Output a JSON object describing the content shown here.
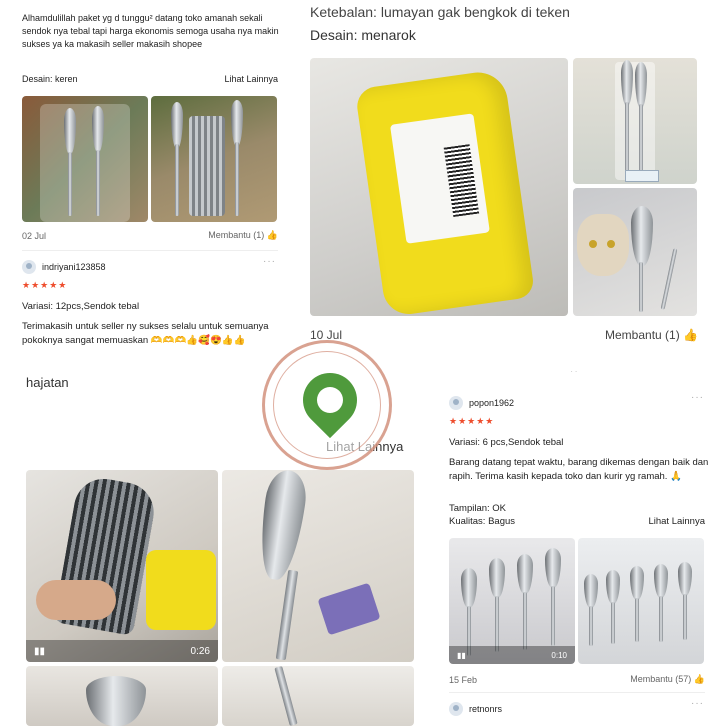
{
  "panel1": {
    "review_text": "Alhamdulillah paket yg d tunggu² datang toko amanah sekali sendok nya tebal tapi harga ekonomis semoga usaha nya makin sukses ya ka makasih seller makasih shopee",
    "design_label": "Desain: keren",
    "see_more": "Lihat Lainnya",
    "date": "02 Jul",
    "helpful": "Membantu (1)",
    "username": "indriyani123858",
    "stars": "★★★★★",
    "variation": "Variasi: 12pcs,Sendok tebal",
    "comment": "Terimakasih untuk seller ny sukses selalu untuk semuanya pokoknya sangat memuaskan 🫶🫶🫶👍🥰😍👍👍"
  },
  "panel2": {
    "cut_line": "Ketebalan: lumayan gak bengkok di teken",
    "design_label": "Desain: menarok",
    "date": "10 Jul",
    "helpful": "Membantu (1)",
    "chevron": "⌄"
  },
  "panel3": {
    "text": "hajatan",
    "see_more": "Lihat Lainnya",
    "video_duration": "0:26"
  },
  "panel4": {
    "username": "popon1962",
    "stars": "★★★★★",
    "variation": "Variasi: 6 pcs,Sendok tebal",
    "comment": "Barang datang tepat waktu, barang dikemas dengan baik dan rapih. Terima kasih kepada toko dan kurir yg ramah. 🙏",
    "display": "Tampilan: OK",
    "quality": "Kualitas: Bagus",
    "see_more": "Lihat Lainnya",
    "video_duration": "0:10",
    "date": "15 Feb",
    "helpful": "Membantu (57)",
    "next_username": "retnonrs"
  },
  "colors": {
    "star": "#ee4d2d",
    "yellow_package": "#f1dc1c",
    "watermark": "#c97a63"
  }
}
